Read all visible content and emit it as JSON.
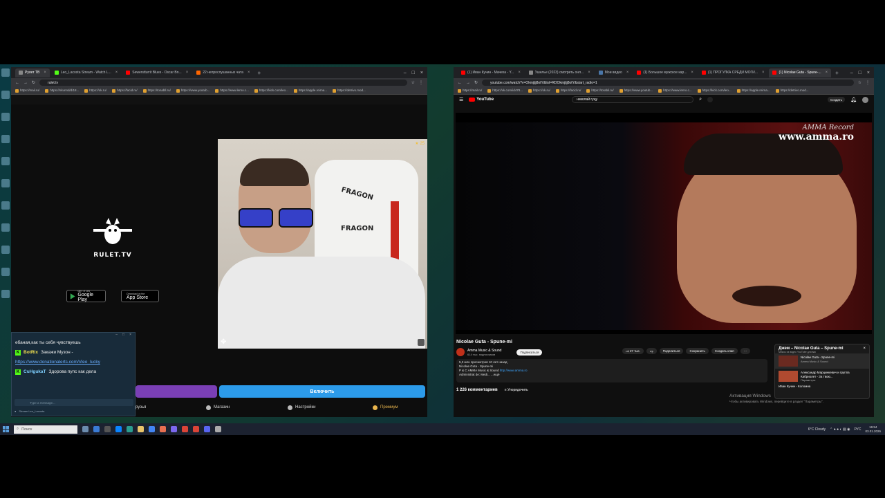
{
  "left_browser": {
    "tabs": [
      {
        "title": "Рулет ТВ",
        "active": true
      },
      {
        "title": "Leo_Lacosta Stream - Watch L...",
        "active": false
      },
      {
        "title": "Sewerstturrit Blues - Oscar Bn...",
        "active": false
      },
      {
        "title": "22 непрослушанных чата",
        "active": false
      }
    ],
    "url": "rulet.tv",
    "bookmarks": [
      "https://mail.ru/",
      "https://nkunnd/d/18...",
      "https://ok.ru/",
      "https://facid.ru/",
      "https://tonabll.ru/",
      "https://www.youtub...",
      "https://www.lerno.c...",
      "https://kick.com/leo...",
      "https://apple.reirna...",
      "https://detrivo.mod..."
    ]
  },
  "rulet": {
    "logo_text": "RULET.TV",
    "google_play_small": "GET IT ON",
    "google_play_big": "Google Play",
    "app_store_small": "Download on the",
    "app_store_big": "App Store",
    "start_button": "Включить",
    "nav": {
      "friends": "рузья",
      "shop": "Магазин",
      "settings": "Настройки",
      "premium": "Премиум"
    },
    "video_badge": "25"
  },
  "chat": {
    "messages": [
      {
        "user": "",
        "text": "ебаная,как ты себя чувствуешь"
      },
      {
        "user": "BotRix",
        "text": "Закажи Музон -"
      },
      {
        "user": "",
        "link": "https://www.donationalerts.com/r/leo_lucky"
      },
      {
        "user": "CuHgukaT",
        "text": "Здорова пупс как дела"
      }
    ],
    "input_placeholder": "Type a message...",
    "footer_user": "Stream Leo_Lacosta"
  },
  "right_browser": {
    "tabs": [
      {
        "title": "(1) Иван Кучин - Мачеха - Y...",
        "active": false
      },
      {
        "title": "Ушелье (2023) смотреть онл...",
        "active": false
      },
      {
        "title": "Мои видео",
        "active": false
      },
      {
        "title": "(1) Большое мужское кар...",
        "active": false
      },
      {
        "title": "(1) ПРОГУЛКА СРЕДИ МОГИ...",
        "active": false
      },
      {
        "title": "(1) Nicolae Guta - Spune-...",
        "active": true
      }
    ],
    "url": "youtube.com/watch?v=Okmjtjj8otY&list=RDOkmjtjj8otY&start_radio=1",
    "bookmarks": [
      "https://mail.ru/",
      "https://vk.com/id478...",
      "https://ok.ru/",
      "https://facid.ru/",
      "https://torabil.ru/",
      "https://www.youtub...",
      "https://www.lerno.c...",
      "https://kick.com/leo...",
      "https://apple.reirna...",
      "https://detrivo.mod..."
    ]
  },
  "youtube": {
    "logo": "YouTube",
    "search_value": "николай гуцу",
    "create_label": "Создать",
    "watermark_1": "AMMA Record",
    "watermark_2": "www.amma.ro",
    "video_title": "Nicolae Guta - Spune-mi",
    "channel": "Amma Music & Sound",
    "subscribers": "614 тыс. подписчиков",
    "subscribe_label": "Подписаться",
    "likes": "27 тыс.",
    "share_label": "Поделиться",
    "save_label": "Сохранить",
    "clip_label": "Создать клип",
    "desc_line1": "5,3 млн просмотров  10 лет назад",
    "desc_line2": "Nicolae Guta - Spune-mi",
    "desc_line3": "P & C AMMA Music & Sound",
    "desc_link": "http://www.amma.ro",
    "desc_line4": "Administrat de: Medi... ...ещё",
    "comments": "1 226 комментариев",
    "sort_label": "Упорядочить",
    "mix_title": "Джем – Nicolae Guta – Spune-mi",
    "mix_sub": "Миксы из видео YouTube для вас",
    "mix_items": [
      {
        "title": "Nicolae Guta - Spune-mi",
        "channel": "Amma Music & Sound"
      },
      {
        "title": "Александр Марцинкевич и группа Кабриолет - За твою...",
        "channel": "Параметры"
      },
      {
        "title": "Иван Кучин - Коломна",
        "channel": ""
      }
    ]
  },
  "activation": {
    "line1": "Активация Windows",
    "line2": "Чтобы активировать Windows, перейдите в раздел \"Параметры\"."
  },
  "taskbar": {
    "search_placeholder": "Поиск",
    "weather": "6°C  Cloudy",
    "lang": "РУС",
    "time": "16:54",
    "date": "03.01.2026"
  }
}
